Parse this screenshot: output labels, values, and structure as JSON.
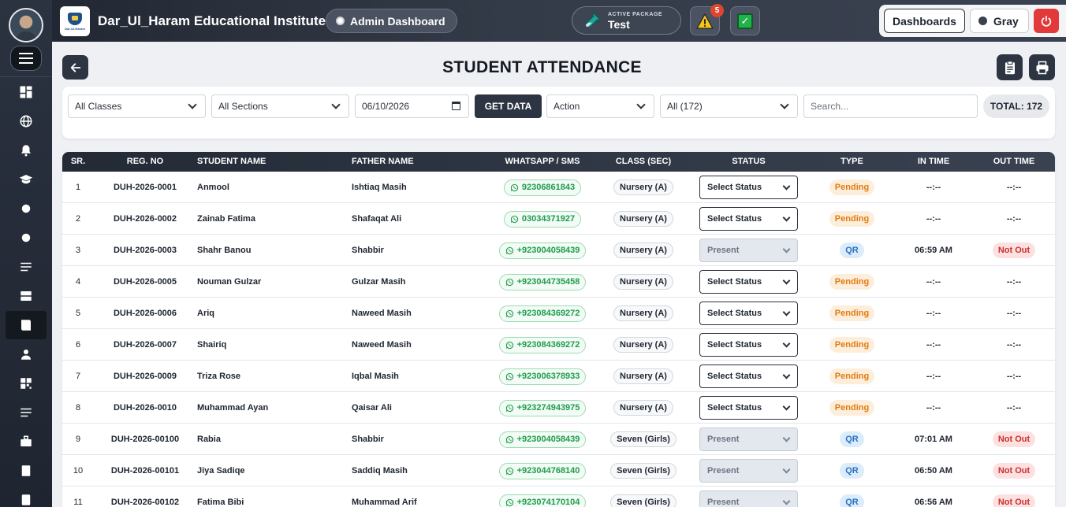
{
  "header": {
    "institute_name": "Dar_Ul_Haram Educational Institute",
    "logo_text": "Dar-Ul-Haram",
    "admin_label": "Admin Dashboard",
    "package_label": "ACTIVE PACKAGE",
    "package_value": "Test",
    "alert_count": "5",
    "dashboards_label": "Dashboards",
    "theme_label": "Gray"
  },
  "page": {
    "title": "STUDENT ATTENDANCE"
  },
  "filters": {
    "class": "All Classes",
    "section": "All Sections",
    "date": "06/10/2026",
    "get_data": "GET DATA",
    "action": "Action",
    "all_count": "All (172)",
    "search_placeholder": "Search...",
    "total": "TOTAL: 172"
  },
  "table": {
    "headers": [
      "SR.",
      "REG. NO",
      "STUDENT NAME",
      "FATHER NAME",
      "WHATSAPP / SMS",
      "CLASS (SEC)",
      "STATUS",
      "TYPE",
      "IN TIME",
      "OUT TIME"
    ],
    "rows": [
      {
        "sr": "1",
        "reg": "DUH-2026-0001",
        "name": "Anmool",
        "father": "Ishtiaq Masih",
        "phone": "92306861843",
        "cls": "Nursery (A)",
        "status": "Select Status",
        "type": "Pending",
        "in": "--:--",
        "out": "--:--"
      },
      {
        "sr": "2",
        "reg": "DUH-2026-0002",
        "name": "Zainab Fatima",
        "father": "Shafaqat Ali",
        "phone": "03034371927",
        "cls": "Nursery (A)",
        "status": "Select Status",
        "type": "Pending",
        "in": "--:--",
        "out": "--:--"
      },
      {
        "sr": "3",
        "reg": "DUH-2026-0003",
        "name": "Shahr Banou",
        "father": "Shabbir",
        "phone": "+923004058439",
        "cls": "Nursery (A)",
        "status": "Present",
        "type": "QR",
        "in": "06:59 AM",
        "out": "Not Out"
      },
      {
        "sr": "4",
        "reg": "DUH-2026-0005",
        "name": "Nouman Gulzar",
        "father": "Gulzar Masih",
        "phone": "+923044735458",
        "cls": "Nursery (A)",
        "status": "Select Status",
        "type": "Pending",
        "in": "--:--",
        "out": "--:--"
      },
      {
        "sr": "5",
        "reg": "DUH-2026-0006",
        "name": "Ariq",
        "father": "Naweed Masih",
        "phone": "+923084369272",
        "cls": "Nursery (A)",
        "status": "Select Status",
        "type": "Pending",
        "in": "--:--",
        "out": "--:--"
      },
      {
        "sr": "6",
        "reg": "DUH-2026-0007",
        "name": "Shairiq",
        "father": "Naweed Masih",
        "phone": "+923084369272",
        "cls": "Nursery (A)",
        "status": "Select Status",
        "type": "Pending",
        "in": "--:--",
        "out": "--:--"
      },
      {
        "sr": "7",
        "reg": "DUH-2026-0009",
        "name": "Triza Rose",
        "father": "Iqbal Masih",
        "phone": "+923006378933",
        "cls": "Nursery (A)",
        "status": "Select Status",
        "type": "Pending",
        "in": "--:--",
        "out": "--:--"
      },
      {
        "sr": "8",
        "reg": "DUH-2026-0010",
        "name": "Muhammad Ayan",
        "father": "Qaisar Ali",
        "phone": "+923274943975",
        "cls": "Nursery (A)",
        "status": "Select Status",
        "type": "Pending",
        "in": "--:--",
        "out": "--:--"
      },
      {
        "sr": "9",
        "reg": "DUH-2026-00100",
        "name": "Rabia",
        "father": "Shabbir",
        "phone": "+923004058439",
        "cls": "Seven (Girls)",
        "status": "Present",
        "type": "QR",
        "in": "07:01 AM",
        "out": "Not Out"
      },
      {
        "sr": "10",
        "reg": "DUH-2026-00101",
        "name": "Jiya Sadiqe",
        "father": "Saddiq Masih",
        "phone": "+923044768140",
        "cls": "Seven (Girls)",
        "status": "Present",
        "type": "QR",
        "in": "06:50 AM",
        "out": "Not Out"
      },
      {
        "sr": "11",
        "reg": "DUH-2026-00102",
        "name": "Fatima Bibi",
        "father": "Muhammad Arif",
        "phone": "+923074170104",
        "cls": "Seven (Girls)",
        "status": "Present",
        "type": "QR",
        "in": "06:56 AM",
        "out": "Not Out"
      }
    ]
  },
  "sidebar": {
    "icons": [
      "dashboard-icon",
      "globe-icon",
      "bell-icon",
      "graduation-cap-icon",
      "circle-icon",
      "circle-icon",
      "list-icon",
      "layout-icon",
      "book-icon",
      "user-icon",
      "grid-icon",
      "menu-lines-icon",
      "briefcase-icon",
      "file-icon",
      "document-icon"
    ]
  },
  "colors": {
    "sidebar": "#2b3240",
    "topbar": "#343b48",
    "accent_dark": "#2d3442",
    "whatsapp_green": "#1f9d4c",
    "pending_orange": "#e07b12",
    "qr_blue": "#2a73c4",
    "notout_red": "#c9302c",
    "power_red": "#e23a3a"
  }
}
